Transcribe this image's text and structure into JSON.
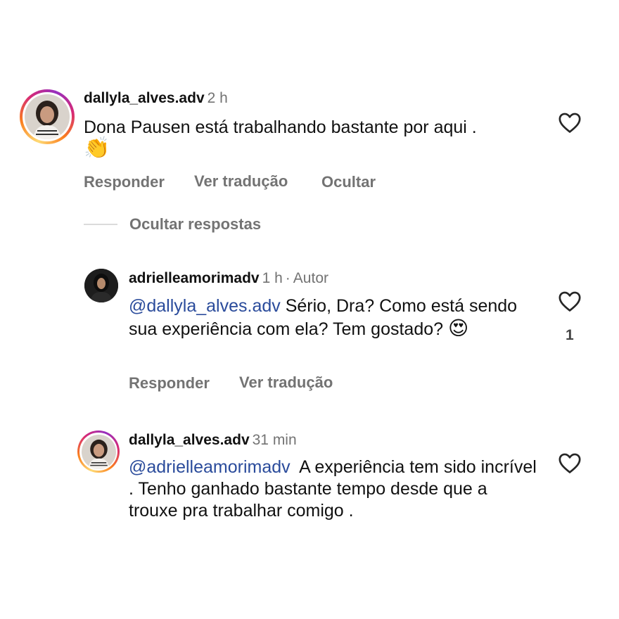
{
  "comments": [
    {
      "username": "dallyla_alves.adv",
      "time": "2 h",
      "text": "Dona Pausen está trabalhando bastante por aqui .",
      "emoji": "👏",
      "actions": [
        "Responder",
        "Ver tradução",
        "Ocultar"
      ]
    }
  ],
  "replies_toggle": "Ocultar respostas",
  "replies": [
    {
      "username": "adrielleamorimadv",
      "time": "1 h",
      "separator": "·",
      "badge": "Autor",
      "mention": "@dallyla_alves.adv",
      "text": " Sério, Dra? Como está sendo sua experiência com ela? Tem gostado? ",
      "emoji": "😍",
      "actions": [
        "Responder",
        "Ver tradução"
      ],
      "likes": "1"
    },
    {
      "username": "dallyla_alves.adv",
      "time": "31 min",
      "mention": "@adrielleamorimadv",
      "text": "  A experiência tem sido incrível . Tenho ganhado bastante tempo desde que a trouxe pra trabalhar comigo ."
    }
  ],
  "colors": {
    "mention": "#2a4b9b",
    "muted": "#737373",
    "story_ring": [
      "#feda75",
      "#fa7e1e",
      "#d62976",
      "#962fbf"
    ]
  },
  "icons": {
    "like": "heart-outline-icon",
    "clap": "clapping-hands-emoji",
    "heart_eyes": "heart-eyes-emoji"
  }
}
